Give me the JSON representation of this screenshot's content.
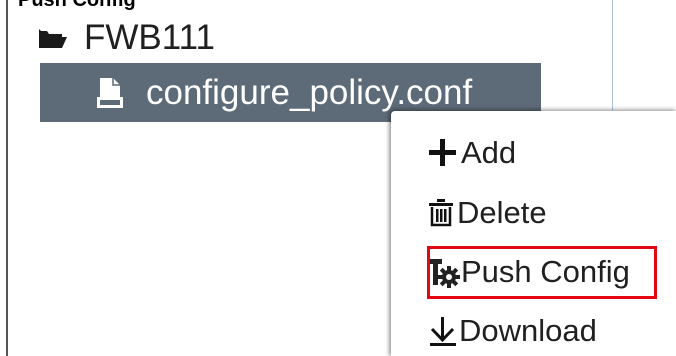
{
  "heading_clipped": "Push Config",
  "tree": {
    "folder": {
      "icon": "folder-open-icon",
      "label": "FWB111"
    },
    "file": {
      "icon": "document-icon",
      "label": "configure_policy.conf",
      "selected_bg": "#5d6a78"
    }
  },
  "context_menu": {
    "items": [
      {
        "icon": "plus-icon",
        "label": "Add"
      },
      {
        "icon": "trash-icon",
        "label": "Delete"
      },
      {
        "icon": "gear-icon",
        "label": "Push Config",
        "highlighted": true
      },
      {
        "icon": "download-arrow-icon",
        "label": "Download"
      }
    ]
  },
  "colors": {
    "highlight_border": "#e30613",
    "selection": "#5d6a78",
    "text": "#202020"
  }
}
